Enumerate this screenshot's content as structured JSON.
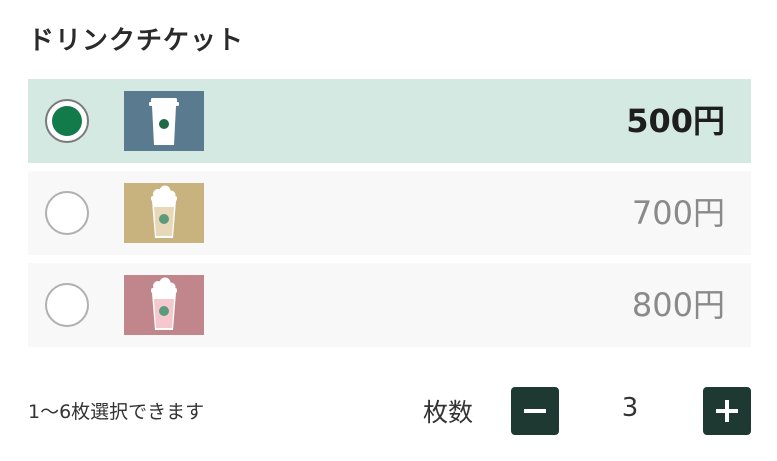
{
  "title": "ドリンクチケット",
  "options": [
    {
      "price": "500円",
      "selected": true,
      "image": "hot-drink-cup-icon",
      "bg": "#5a7a8f"
    },
    {
      "price": "700円",
      "selected": false,
      "image": "frappuccino-cup-icon",
      "bg": "#c8b27e"
    },
    {
      "price": "800円",
      "selected": false,
      "image": "pink-frappuccino-cup-icon",
      "bg": "#c0868b"
    }
  ],
  "quantity": {
    "note": "1〜6枚選択できます",
    "label": "枚数",
    "value": "3"
  },
  "colors": {
    "accent_green": "#137a4a",
    "selected_bg": "#d4e9e2",
    "button_bg": "#1e3932"
  }
}
